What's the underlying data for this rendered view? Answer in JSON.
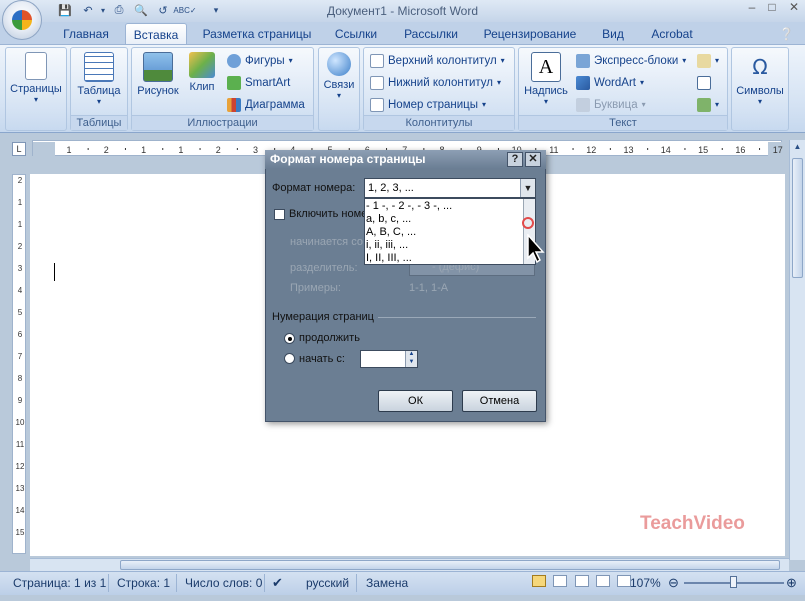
{
  "window": {
    "title": "Документ1 - Microsoft Word",
    "qat_icons": [
      "save-icon",
      "undo-icon",
      "redo-icon",
      "print-icon",
      "preview-icon",
      "spell-icon"
    ],
    "controls": [
      "–",
      "□",
      "✕"
    ]
  },
  "tabs": [
    "Главная",
    "Вставка",
    "Разметка страницы",
    "Ссылки",
    "Рассылки",
    "Рецензирование",
    "Вид",
    "Acrobat"
  ],
  "ribbon": {
    "groups": {
      "pages": {
        "button": "Страницы"
      },
      "tables": {
        "button": "Таблица",
        "label": "Таблицы"
      },
      "illustrations": {
        "picture": "Рисунок",
        "clip": "Клип",
        "shapes": "Фигуры",
        "smartart": "SmartArt",
        "chart": "Диаграмма",
        "label": "Иллюстрации"
      },
      "links": {
        "button": "Связи"
      },
      "headers": {
        "header": "Верхний колонтитул",
        "footer": "Нижний колонтитул",
        "page_number": "Номер страницы",
        "label": "Колонтитулы"
      },
      "text": {
        "textbox": "Надпись",
        "quickparts": "Экспресс-блоки",
        "wordart": "WordArt",
        "dropcap": "Буквица",
        "label": "Текст"
      },
      "symbols": {
        "button": "Символы"
      }
    }
  },
  "ruler": {
    "tab_selector": "L",
    "numbers": [
      "1",
      "2",
      "1",
      "1",
      "2",
      "3",
      "4",
      "5",
      "6",
      "7",
      "8",
      "9",
      "10",
      "11",
      "12",
      "13",
      "14",
      "15",
      "16",
      "17"
    ],
    "left_numbers": [
      "2",
      "1",
      "1",
      "2",
      "3",
      "4",
      "5",
      "6",
      "7",
      "8",
      "9",
      "10",
      "11",
      "12",
      "13",
      "14",
      "15"
    ]
  },
  "dialog": {
    "title": "Формат номера страницы",
    "help": "?",
    "close": "✕",
    "format_label": "Формат номера:",
    "format_value": "1, 2, 3, ...",
    "dropdown_options": [
      "- 1 -, - 2 -, - 3 -, ...",
      "a, b, c, ...",
      "A, B, C, ...",
      "i, ii, iii, ...",
      "I, II, III, ..."
    ],
    "include_chapter": "Включить номер",
    "starts_with": "начинается со",
    "separator_label": "разделитель:",
    "separator_value": "- (дефис)",
    "examples_label": "Примеры:",
    "examples_value": "1-1, 1-A",
    "numbering_section": "Нумерация страниц",
    "continue_label": "продолжить",
    "start_at_label": "начать с:",
    "ok": "ОК",
    "cancel": "Отмена"
  },
  "statusbar": {
    "page": "Страница: 1 из 1",
    "words_lines": "Строка: 1",
    "word_count": "Число слов: 0",
    "language": "русский",
    "mode": "Замена",
    "zoom": "107%"
  },
  "watermark": "TeachVideo",
  "colors": {
    "ribbon_bg": "#d4e2f3",
    "dialog_bg": "#6b7e93",
    "accent": "#15428b"
  }
}
